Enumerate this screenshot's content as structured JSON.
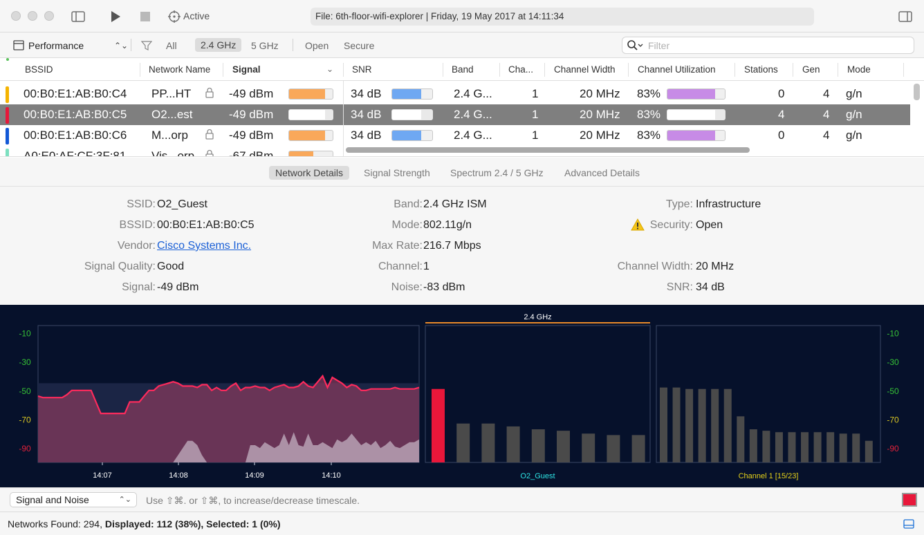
{
  "titlebar": {
    "active_label": "Active",
    "file_info": "File: 6th-floor-wifi-explorer | Friday, 19 May 2017 at 14:11:34"
  },
  "toolbar": {
    "view_select": "Performance",
    "filters": [
      "All",
      "2.4 GHz",
      "5 GHz",
      "Open",
      "Secure"
    ],
    "active_filter": "2.4 GHz",
    "filter_placeholder": "Filter"
  },
  "table": {
    "columns": [
      "BSSID",
      "Network Name",
      "Signal",
      "SNR",
      "Band",
      "Cha...",
      "Channel Width",
      "Channel Utilization",
      "Stations",
      "Gen",
      "Mode"
    ],
    "rows": [
      {
        "color": "#f5b400",
        "bssid": "00:B0:E1:AB:B0:C4",
        "name": "PP...HT",
        "locked": true,
        "signal": "-49 dBm",
        "signal_level": 0.82,
        "snr": "34 dB",
        "snr_level": 0.72,
        "band": "2.4 G...",
        "channel": "1",
        "width": "20 MHz",
        "util": "83%",
        "util_level": 0.83,
        "stations": "0",
        "gen": "4",
        "mode": "g/n",
        "selected": false
      },
      {
        "color": "#e8173a",
        "bssid": "00:B0:E1:AB:B0:C5",
        "name": "O2...est",
        "locked": false,
        "signal": "-49 dBm",
        "signal_level": 0.82,
        "snr": "34 dB",
        "snr_level": 0.72,
        "band": "2.4 G...",
        "channel": "1",
        "width": "20 MHz",
        "util": "83%",
        "util_level": 0.83,
        "stations": "4",
        "gen": "4",
        "mode": "g/n",
        "selected": true
      },
      {
        "color": "#1358d6",
        "bssid": "00:B0:E1:AB:B0:C6",
        "name": "M...orp",
        "locked": true,
        "signal": "-49 dBm",
        "signal_level": 0.82,
        "snr": "34 dB",
        "snr_level": 0.72,
        "band": "2.4 G...",
        "channel": "1",
        "width": "20 MHz",
        "util": "83%",
        "util_level": 0.83,
        "stations": "0",
        "gen": "4",
        "mode": "g/n",
        "selected": false
      },
      {
        "color": "#7de0c0",
        "bssid": "A0:E0:AF:CF:3F:81",
        "name": "Vis...orp",
        "locked": true,
        "signal": "-67 dBm",
        "signal_level": 0.55,
        "snr": "",
        "snr_level": 0,
        "band": "",
        "channel": "",
        "width": "",
        "util": "",
        "util_level": 0,
        "stations": "",
        "gen": "",
        "mode": "",
        "selected": false
      }
    ]
  },
  "detail_tabs": [
    "Network Details",
    "Signal Strength",
    "Spectrum 2.4 / 5 GHz",
    "Advanced Details"
  ],
  "details": {
    "ssid_label": "SSID:",
    "ssid": "O2_Guest",
    "bssid_label": "BSSID:",
    "bssid": "00:B0:E1:AB:B0:C5",
    "vendor_label": "Vendor:",
    "vendor": "Cisco Systems Inc.",
    "quality_label": "Signal Quality:",
    "quality": "Good",
    "signal_label": "Signal:",
    "signal": "-49 dBm",
    "band_label": "Band:",
    "band": "2.4 GHz ISM",
    "mode_label": "Mode:",
    "mode": "802.11g/n",
    "rate_label": "Max Rate:",
    "rate": "216.7 Mbps",
    "channel_label": "Channel:",
    "channel": "1",
    "noise_label": "Noise:",
    "noise": "-83 dBm",
    "type_label": "Type:",
    "type": "Infrastructure",
    "security_label": "Security:",
    "security": "Open",
    "width_label": "Channel Width:",
    "width": "20 MHz",
    "snr_label": "SNR:",
    "snr": "34 dB"
  },
  "chart_data": [
    {
      "type": "area",
      "title": "",
      "yticks": [
        "-10",
        "-30",
        "-50",
        "-70",
        "-90"
      ],
      "xticks": [
        "14:07",
        "14:08",
        "14:09",
        "14:10"
      ],
      "ylim": [
        -100,
        -5
      ],
      "grid": false,
      "series": [
        {
          "values": [
            -54,
            -55,
            -55,
            -55,
            -55,
            -55,
            -53,
            -50,
            -50,
            -50,
            -50,
            -50,
            -58,
            -66,
            -66,
            -66,
            -66,
            -66,
            -66,
            -58,
            -58,
            -58,
            -54,
            -50,
            -50,
            -47,
            -46,
            -45,
            -44,
            -45,
            -47,
            -47,
            -47,
            -48,
            -46,
            -46,
            -50,
            -48,
            -50,
            -50,
            -47,
            -45,
            -50,
            -48,
            -48,
            -47,
            -48,
            -48,
            -50,
            -48,
            -47,
            -46,
            -48,
            -48,
            -47,
            -44,
            -47,
            -48,
            -44,
            -40,
            -48,
            -41,
            -43,
            -45,
            -48,
            -46,
            -47,
            -50,
            -50,
            -49,
            -49,
            -49,
            -49,
            -49,
            -48,
            -49,
            -49,
            -49,
            -49,
            -48
          ]
        },
        {
          "values": [
            -100,
            -100,
            -100,
            -100,
            -100,
            -100,
            -100,
            -100,
            -100,
            -100,
            -100,
            -100,
            -100,
            -100,
            -100,
            -100,
            -100,
            -100,
            -100,
            -100,
            -100,
            -100,
            -100,
            -100,
            -100,
            -100,
            -100,
            -100,
            -100,
            -95,
            -90,
            -85,
            -85,
            -88,
            -95,
            -100,
            -100,
            -100,
            -100,
            -100,
            -100,
            -100,
            -100,
            -100,
            -88,
            -88,
            -90,
            -86,
            -88,
            -90,
            -88,
            -80,
            -88,
            -79,
            -88,
            -89,
            -80,
            -88,
            -88,
            -86,
            -88,
            -90,
            -84,
            -86,
            -84,
            -80,
            -84,
            -88,
            -86,
            -88,
            -85,
            -90,
            -88,
            -85,
            -89,
            -90,
            -88,
            -86,
            -86,
            -84
          ]
        }
      ]
    },
    {
      "type": "bar",
      "title": "2.4 GHz",
      "xlabel": "O2_Guest",
      "ylim": [
        -100,
        -5
      ],
      "values": [
        -49,
        -73,
        -73,
        -75,
        -77,
        -78,
        -80,
        -81,
        -81
      ],
      "colors": [
        "#e8173a",
        "#4a4a4a",
        "#4a4a4a",
        "#4a4a4a",
        "#4a4a4a",
        "#4a4a4a",
        "#4a4a4a",
        "#4a4a4a",
        "#4a4a4a"
      ]
    },
    {
      "type": "bar",
      "xlabel": "Channel 1 [15/23]",
      "ylim": [
        -100,
        -5
      ],
      "values": [
        -48,
        -48,
        -49,
        -49,
        -49,
        -49,
        -68,
        -77,
        -78,
        -79,
        -79,
        -79,
        -79,
        -79,
        -80,
        -80,
        -85
      ]
    }
  ],
  "bottom": {
    "mode_select": "Signal and Noise",
    "hint": "Use ⇧⌘. or ⇧⌘, to increase/decrease timescale."
  },
  "status": {
    "found_label": "Networks Found: 294, ",
    "displayed": "Displayed: 112 (38%), Selected: 1 (0%)"
  }
}
